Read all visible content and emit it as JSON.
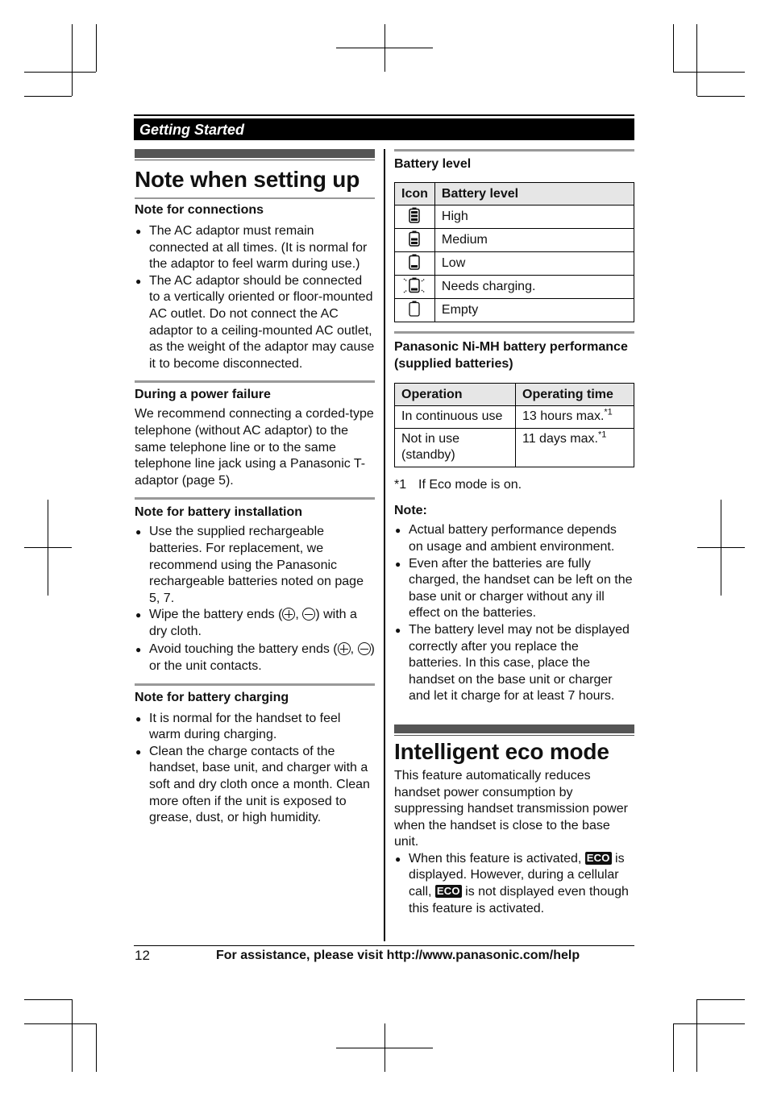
{
  "header": {
    "section_title": "Getting Started"
  },
  "left": {
    "title": "Note when setting up",
    "connections": {
      "heading": "Note for connections",
      "bullets": [
        "The AC adaptor must remain connected at all times. (It is normal for the adaptor to feel warm during use.)",
        "The AC adaptor should be connected to a vertically oriented or floor-mounted AC outlet. Do not connect the AC adaptor to a ceiling-mounted AC outlet, as the weight of the adaptor may cause it to become disconnected."
      ]
    },
    "power_failure": {
      "heading": "During a power failure",
      "text": "We recommend connecting a corded-type telephone (without AC adaptor) to the same telephone line or to the same telephone line jack using a Panasonic T-adaptor (page 5)."
    },
    "battery_installation": {
      "heading": "Note for battery installation",
      "bullet1": "Use the supplied rechargeable batteries. For replacement, we recommend using the Panasonic rechargeable batteries noted on page 5, 7.",
      "bullet2_a": "Wipe the battery ends (",
      "bullet2_b": ", ",
      "bullet2_c": ") with a dry cloth.",
      "bullet3_a": "Avoid touching the battery ends (",
      "bullet3_b": ", ",
      "bullet3_c": ") or the unit contacts."
    },
    "battery_charging": {
      "heading": "Note for battery charging",
      "bullets": [
        "It is normal for the handset to feel warm during charging.",
        "Clean the charge contacts of the handset, base unit, and charger with a soft and dry cloth once a month. Clean more often if the unit is exposed to grease, dust, or high humidity."
      ]
    }
  },
  "right": {
    "battery_level": {
      "heading": "Battery level",
      "columns": [
        "Icon",
        "Battery level"
      ],
      "rows": [
        {
          "icon": "battery-high-icon",
          "label": "High"
        },
        {
          "icon": "battery-medium-icon",
          "label": "Medium"
        },
        {
          "icon": "battery-low-icon",
          "label": "Low"
        },
        {
          "icon": "battery-needs-charging-icon",
          "label": "Needs charging."
        },
        {
          "icon": "battery-empty-icon",
          "label": "Empty"
        }
      ]
    },
    "performance": {
      "heading": "Panasonic Ni-MH battery performance (supplied batteries)",
      "columns": [
        "Operation",
        "Operating time"
      ],
      "rows": [
        {
          "operation": "In continuous use",
          "time": "13 hours max.",
          "note": "*1"
        },
        {
          "operation": "Not in use (standby)",
          "time": "11 days max.",
          "note": "*1"
        }
      ],
      "footnote_mark": "*1",
      "footnote": "If Eco mode is on."
    },
    "note": {
      "heading": "Note:",
      "bullets": [
        "Actual battery performance depends on usage and ambient environment.",
        "Even after the batteries are fully charged, the handset can be left on the base unit or charger without any ill effect on the batteries.",
        "The battery level may not be displayed correctly after you replace the batteries. In this case, place the handset on the base unit or charger and let it charge for at least 7 hours."
      ]
    },
    "eco": {
      "title": "Intelligent eco mode",
      "text": "This feature automatically reduces handset power consumption by suppressing handset transmission power when the handset is close to the base unit.",
      "badge": "ECO",
      "bullet_a": "When this feature is activated, ",
      "bullet_b": " is displayed. However, during a cellular call, ",
      "bullet_c": " is not displayed even though this feature is activated."
    }
  },
  "footer": {
    "page_number": "12",
    "text": "For assistance, please visit http://www.panasonic.com/help"
  }
}
